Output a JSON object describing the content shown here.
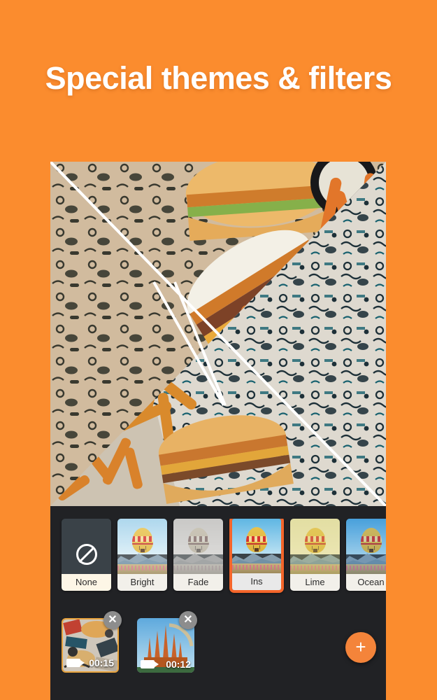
{
  "headline": "Special themes & filters",
  "colors": {
    "background_orange": "#fb8c2e",
    "accent_orange": "#f4652a",
    "fab_orange": "#f4843a",
    "panel_dark": "#212225",
    "clip_border": "#e8a33d"
  },
  "preview": {
    "name": "food-photo-preview",
    "description": "Burgers and fries on patterned wrapping paper, split diagonally to compare filters"
  },
  "filters": {
    "label": "filter-strip",
    "items": [
      {
        "label": "None",
        "icon": "no-filter-icon",
        "selected": false
      },
      {
        "label": "Bright",
        "icon": "balloon-thumbnail",
        "selected": false
      },
      {
        "label": "Fade",
        "icon": "balloon-thumbnail",
        "selected": false
      },
      {
        "label": "Ins",
        "icon": "balloon-thumbnail",
        "selected": true
      },
      {
        "label": "Lime",
        "icon": "balloon-thumbnail",
        "selected": false
      },
      {
        "label": "Ocean",
        "icon": "balloon-thumbnail",
        "selected": false
      }
    ]
  },
  "timeline": {
    "label": "clip-timeline",
    "clips": [
      {
        "duration": "00:15",
        "selected": true,
        "close_label": "✕",
        "icon": "video-camera-icon"
      },
      {
        "duration": "00:12",
        "selected": false,
        "close_label": "✕",
        "icon": "video-camera-icon"
      }
    ],
    "add_button_label": "+"
  }
}
